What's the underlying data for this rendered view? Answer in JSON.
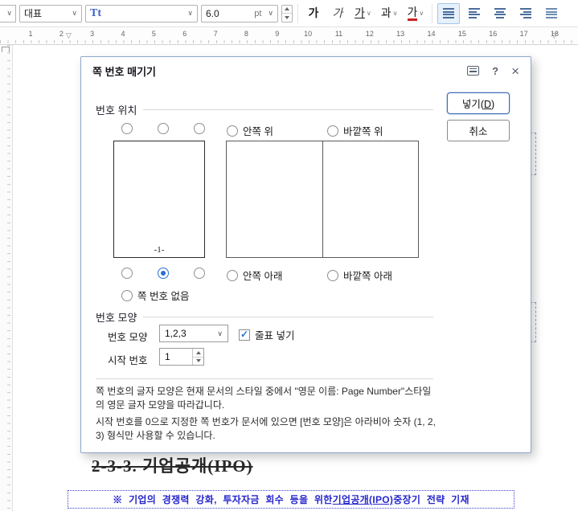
{
  "icons": {
    "dropdown_arrow": "∨",
    "help": "?",
    "close": "×",
    "check": "✓",
    "ruler_marker": "▽"
  },
  "toolbar": {
    "style_combo_value": "대표",
    "font_combo_glyph": "Tt",
    "size_value": "6.0",
    "size_unit": "pt",
    "bold_label": "가",
    "italic_label": "가",
    "underline_label": "가",
    "outline_label": "과",
    "color_label": "가"
  },
  "ruler": {
    "numbers": [
      "1",
      "2",
      "3",
      "4",
      "5",
      "6",
      "7",
      "8",
      "9",
      "10",
      "11",
      "12",
      "13",
      "14",
      "15",
      "16",
      "17",
      "18"
    ]
  },
  "dialog": {
    "title": "쪽 번호 매기기",
    "insert_button_pre": "넣기(",
    "insert_button_key": "D",
    "insert_button_post": ")",
    "cancel_button": "취소",
    "position": {
      "section_label": "번호 위치",
      "inside_top": "안쪽 위",
      "outside_top": "바깥쪽 위",
      "inside_bottom": "안쪽 아래",
      "outside_bottom": "바깥쪽 아래",
      "none": "쪽 번호 없음",
      "preview_number": "-1-"
    },
    "shape": {
      "section_label": "번호 모양",
      "shape_label": "번호 모양",
      "shape_value": "1,2,3",
      "dash_label": "줄표 넣기",
      "start_label": "시작 번호",
      "start_value": "1"
    },
    "description1": "쪽 번호의 글자 모양은 현재 문서의 스타일 중에서 \"영문 이름: Page Number\"스타일의 영문 글자 모양을 따라갑니다.",
    "description2": "시작 번호를 0으로 지정한 쪽 번호가 문서에 있으면 [번호 모양]은 아라비아 숫자 (1, 2, 3) 형식만 사용할 수 있습니다."
  },
  "document": {
    "heading": "2-3-3. 기업공개(IPO)",
    "note_prefix": "※ 기업의 경쟁력 강화, 투자자금 회수 등을 위한 ",
    "note_link": "기업공개(IPO)",
    "note_suffix": " 중장기 전략 기재"
  }
}
